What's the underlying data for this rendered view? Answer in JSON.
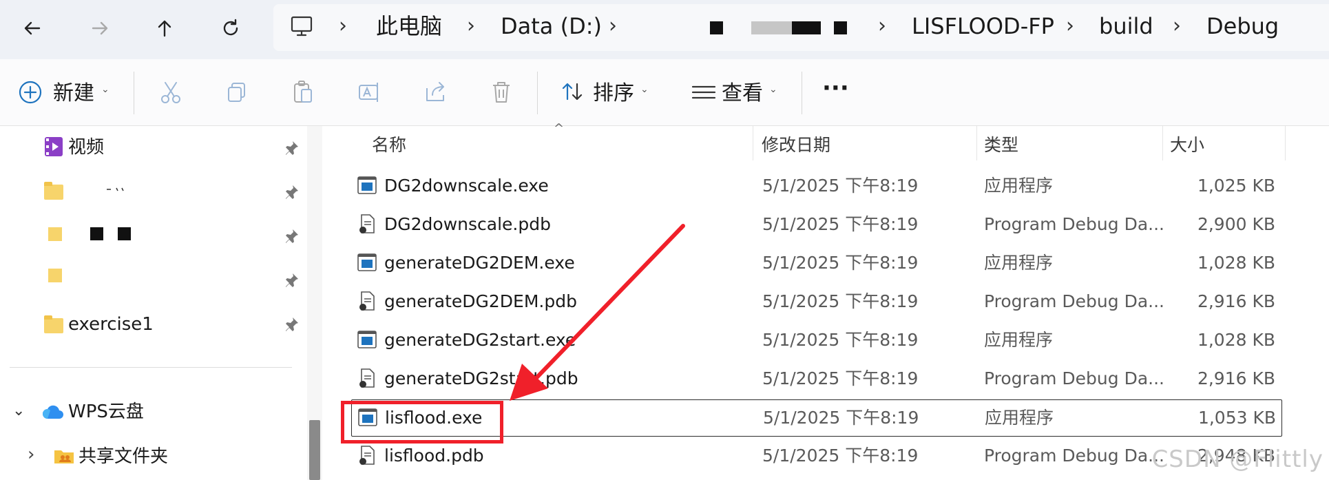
{
  "breadcrumb": {
    "root": "此电脑",
    "drive": "Data (D:)",
    "folder1": "LISFLOOD-FP",
    "folder2": "build",
    "folder3": "Debug"
  },
  "toolbar": {
    "new_label": "新建",
    "sort_label": "排序",
    "view_label": "查看",
    "more_label": "···"
  },
  "sidebar": {
    "items": [
      {
        "label": "视频"
      },
      {
        "label": "exercise1"
      },
      {
        "label": "WPS云盘"
      },
      {
        "label": "共享文件夹"
      }
    ]
  },
  "columns": {
    "name": "名称",
    "modified": "修改日期",
    "type": "类型",
    "size": "大小"
  },
  "files": [
    {
      "name": "DG2downscale.exe",
      "date": "5/1/2025 下午8:19",
      "type": "应用程序",
      "size": "1,025 KB",
      "kind": "exe"
    },
    {
      "name": "DG2downscale.pdb",
      "date": "5/1/2025 下午8:19",
      "type": "Program Debug Da...",
      "size": "2,900 KB",
      "kind": "pdb"
    },
    {
      "name": "generateDG2DEM.exe",
      "date": "5/1/2025 下午8:19",
      "type": "应用程序",
      "size": "1,028 KB",
      "kind": "exe"
    },
    {
      "name": "generateDG2DEM.pdb",
      "date": "5/1/2025 下午8:19",
      "type": "Program Debug Da...",
      "size": "2,916 KB",
      "kind": "pdb"
    },
    {
      "name": "generateDG2start.exe",
      "date": "5/1/2025 下午8:19",
      "type": "应用程序",
      "size": "1,028 KB",
      "kind": "exe"
    },
    {
      "name": "generateDG2start.pdb",
      "date": "5/1/2025 下午8:19",
      "type": "Program Debug Da...",
      "size": "2,916 KB",
      "kind": "pdb"
    },
    {
      "name": "lisflood.exe",
      "date": "5/1/2025 下午8:19",
      "type": "应用程序",
      "size": "1,053 KB",
      "kind": "exe",
      "selected": true
    },
    {
      "name": "lisflood.pdb",
      "date": "5/1/2025 下午8:19",
      "type": "Program Debug Da...",
      "size": "2,948 KB",
      "kind": "pdb"
    }
  ],
  "watermark": "CSDN @Flittly",
  "colors": {
    "accent": "#1e73be",
    "annotation": "#f0202a"
  }
}
